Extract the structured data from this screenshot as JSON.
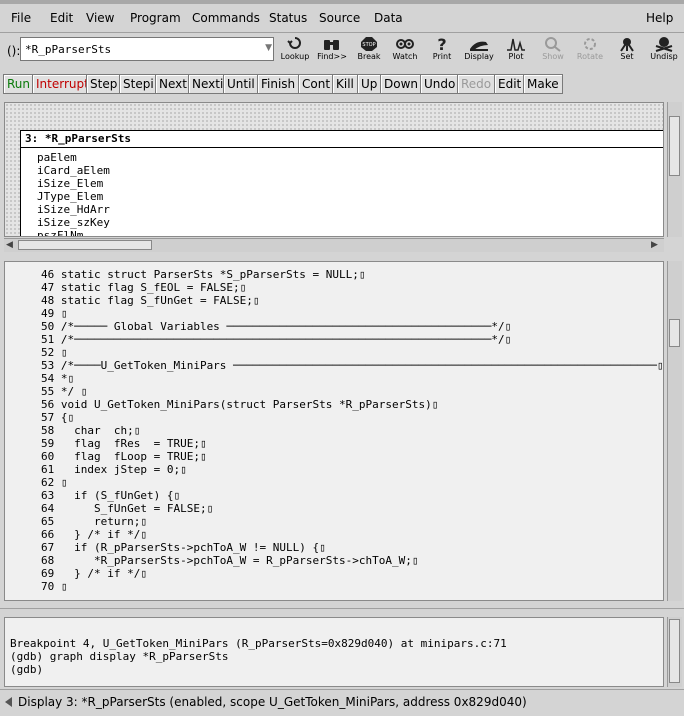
{
  "menu": {
    "file": "File",
    "edit": "Edit",
    "view": "View",
    "program": "Program",
    "commands": "Commands",
    "status": "Status",
    "source": "Source",
    "data": "Data",
    "help": "Help"
  },
  "argfield": {
    "prefix": "():",
    "value": "*R_pParserSts"
  },
  "tools": {
    "lookup": "Lookup",
    "find": "Find>>",
    "brk": "Break",
    "watch": "Watch",
    "print": "Print",
    "display": "Display",
    "plot": "Plot",
    "show": "Show",
    "rotate": "Rotate",
    "set": "Set",
    "undisp": "Undisp"
  },
  "commands": {
    "run": "Run",
    "interrupt": "Interrupt",
    "step": "Step",
    "stepi": "Stepi",
    "next": "Next",
    "nexti": "Nexti",
    "until": "Until",
    "finish": "Finish",
    "cont": "Cont",
    "kill": "Kill",
    "up": "Up",
    "down": "Down",
    "undo": "Undo",
    "redo": "Redo",
    "edit": "Edit",
    "make": "Make"
  },
  "display": {
    "title": "3: *R_pParserSts",
    "members": [
      "paElem",
      "iCard_aElem",
      "iSize_Elem",
      "JType_Elem",
      "iSize_HdArr",
      "iSize_szKey",
      "pszFlNm"
    ]
  },
  "source": {
    "lines": [
      "46 static struct ParserSts *S_pParserSts = NULL;▯",
      "47 static flag S_fEOL = FALSE;▯",
      "48 static flag S_fUnGet = FALSE;▯",
      "49 ▯",
      "50 /*───── Global Variables ────────────────────────────────────────*/▯",
      "51 /*───────────────────────────────────────────────────────────────*/▯",
      "52 ▯",
      "53 /*────U_GetToken_MiniPars ────────────────────────────────────────────────────────────────▯",
      "54 *▯",
      "55 */ ▯",
      "56 void U_GetToken_MiniPars(struct ParserSts *R_pParserSts)▯",
      "57 {▯",
      "58   char  ch;▯",
      "59   flag  fRes  = TRUE;▯",
      "60   flag  fLoop = TRUE;▯",
      "61   index jStep = 0;▯",
      "62 ▯",
      "63   if (S_fUnGet) {▯",
      "64      S_fUnGet = FALSE;▯",
      "65      return;▯",
      "66   } /* if */▯",
      "67   if (R_pParserSts->pchToA_W != NULL) {▯",
      "68      *R_pParserSts->pchToA_W = R_pParserSts->chToA_W;▯",
      "69   } /* if */▯",
      "70 ▯"
    ]
  },
  "console": {
    "lines": [
      "Breakpoint 4, U_GetToken_MiniPars (R_pParserSts=0x829d040) at minipars.c:71",
      "(gdb) graph display *R_pParserSts",
      "(gdb) "
    ]
  },
  "status": {
    "text": "Display 3: *R_pParserSts (enabled, scope U_GetToken_MiniPars, address 0x829d040)"
  }
}
